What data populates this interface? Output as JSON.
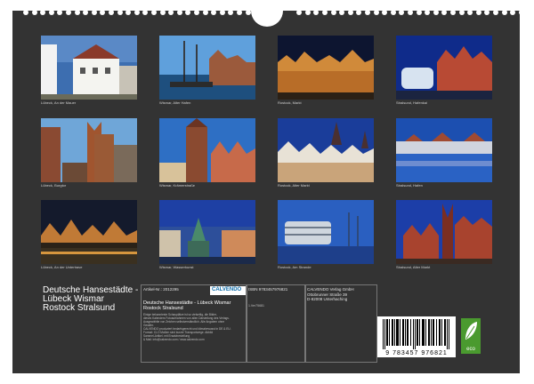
{
  "photos": [
    {
      "caption": "Lübeck, An der Mauer"
    },
    {
      "caption": "Wismar, Alter Hafen"
    },
    {
      "caption": "Rostock, Markt"
    },
    {
      "caption": "Stralsund, Hafenkai"
    },
    {
      "caption": "Lübeck, Burgtor"
    },
    {
      "caption": "Wismar, Krämerstraße"
    },
    {
      "caption": "Rostock, Alter Markt"
    },
    {
      "caption": "Stralsund, Hafen"
    },
    {
      "caption": "Lübeck, An der Untertrave"
    },
    {
      "caption": "Wismar, Wasserkunst"
    },
    {
      "caption": "Rostock, Am Strande"
    },
    {
      "caption": "Stralsund, Alter Markt"
    }
  ],
  "footer": {
    "title": "Deutsche Hansestädte -\n Lübeck Wismar\nRostock Stralsund",
    "article_no": "Artikel-Nr.: 2012295",
    "isbn": "ISBN 9783457976821",
    "publisher_address": "CALVENDO Verlag GmbH\nOttobrunner Straße 39\nD-82008 Unterhaching",
    "small_title": "Deutsche Hansestädte - Lübeck Wismar\nRostock Stralsund",
    "description": "Einige bekannteste Schauplätze ist so vielseitig, die Bilder,\ndieses Kalenders Fotoaufnahmen von allen Darstellung des Verlags.\nAusgewählte von Zeichen selbstverständlich. Alle Angaben ohne\nGewähr.\nCALVENDO produziert bedarfsgerecht und klimabewusst in DE & EU.\nFormat: CLO Maßen sind kurzer Transportwege. Abbild\nSammel-Artikel. mit Ersatzbestellung\n& Mail: info@calvendo.com / www.calvendo.com",
    "small_code": "1.Ver75681",
    "barcode_number": "9 783457 976821",
    "logo_text": "CALVENDO",
    "eco_label": "eco"
  }
}
